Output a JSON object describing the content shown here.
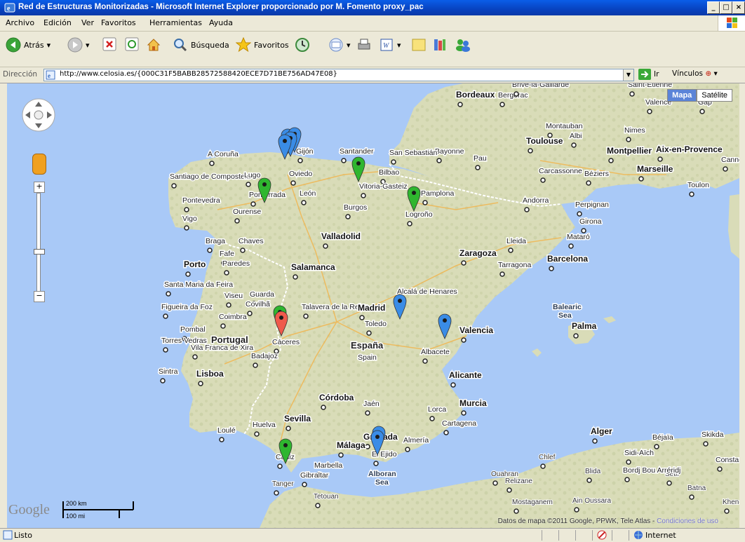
{
  "window": {
    "title": "Red de Estructuras Monitorizadas - Microsoft Internet Explorer proporcionado por M. Fomento proxy_pac"
  },
  "menu": [
    "Archivo",
    "Edición",
    "Ver",
    "Favoritos",
    "Herramientas",
    "Ayuda"
  ],
  "toolbar": {
    "back": "Atrás",
    "search": "Búsqueda",
    "favorites": "Favoritos"
  },
  "address": {
    "label": "Dirección",
    "url": "http://www.celosia.es/{000C31F5BABB28572588420ECE7D71BE756AD47E08}",
    "go": "Ir",
    "links": "Vínculos"
  },
  "map": {
    "type_buttons": {
      "map": "Mapa",
      "satellite": "Satélite"
    },
    "scale": {
      "km": "200 km",
      "mi": "100 mi"
    },
    "logo": "Google",
    "copyright": "Datos de mapa ©2011 Google, PPWK, Tele Atlas",
    "terms": "Condiciones de uso",
    "countries": {
      "spain": "España",
      "spain_en": "Spain",
      "portugal": "Portugal"
    },
    "seas": {
      "balearic": "Balearic Sea",
      "alboran": "Alboran Sea"
    },
    "marker_colors": {
      "blue": "#3a8ce6",
      "green": "#2fb62f",
      "red": "#ef5a4c"
    },
    "cities": [
      "Bordeaux",
      "Bergerac",
      "Montauban",
      "Albi",
      "Toulouse",
      "Montpellier",
      "Nimes",
      "Valence",
      "Gap",
      "Aix-en-Provence",
      "Marseille",
      "Toulon",
      "Carcassonne",
      "Béziers",
      "Cannes",
      "Pau",
      "Bayonne",
      "San Sebastián",
      "Bilbao",
      "Santander",
      "Gijón",
      "Oviedo",
      "A Coruña",
      "Santiago de Compostela",
      "Lugo",
      "León",
      "Ponferrada",
      "Pontevedra",
      "Ourense",
      "Vigo",
      "Vitoria-Gasteiz",
      "Pamplona",
      "Burgos",
      "Logroño",
      "Andorra",
      "Perpignan",
      "Girona",
      "Lleida",
      "Mataró",
      "Barcelona",
      "Tarragona",
      "Zaragoza",
      "Valladolid",
      "Braga",
      "Chaves",
      "Fafe",
      "Porto",
      "Paredes",
      "Salamanca",
      "Santa Maria da Feira",
      "Viseu",
      "Guarda",
      "Covilhã",
      "Figueira da Foz",
      "Coimbra",
      "Pombal",
      "Talavera de la Reina",
      "Madrid",
      "Alcalá de Henares",
      "Toledo",
      "Cáceres",
      "Torres Vedras",
      "Vila Franca de Xira",
      "Badajoz",
      "Sintra",
      "Lisboa",
      "Valencia",
      "Palma",
      "Albacete",
      "Alicante",
      "Murcia",
      "Córdoba",
      "Jaén",
      "Lorca",
      "Cartagena",
      "Sevilla",
      "Huelva",
      "Loulé",
      "Granada",
      "Almería",
      "El Ejido",
      "Málaga",
      "Marbella",
      "Gibraltar",
      "Cádiz",
      "Tanger",
      "Tetouan",
      "Ouahran",
      "Relizane",
      "Chlef",
      "Alger",
      "Blida",
      "Béjaïa",
      "Skikda",
      "Sétif",
      "Batna",
      "Khenchela",
      "Sidi-Aïch",
      "Bordj Bou Arréridj",
      "Ain Oussara",
      "Mostaganem",
      "Constantine",
      "Saint-Etienne",
      "Brive-la-Gaillarde"
    ]
  },
  "status": {
    "text": "Listo",
    "zone": "Internet"
  }
}
